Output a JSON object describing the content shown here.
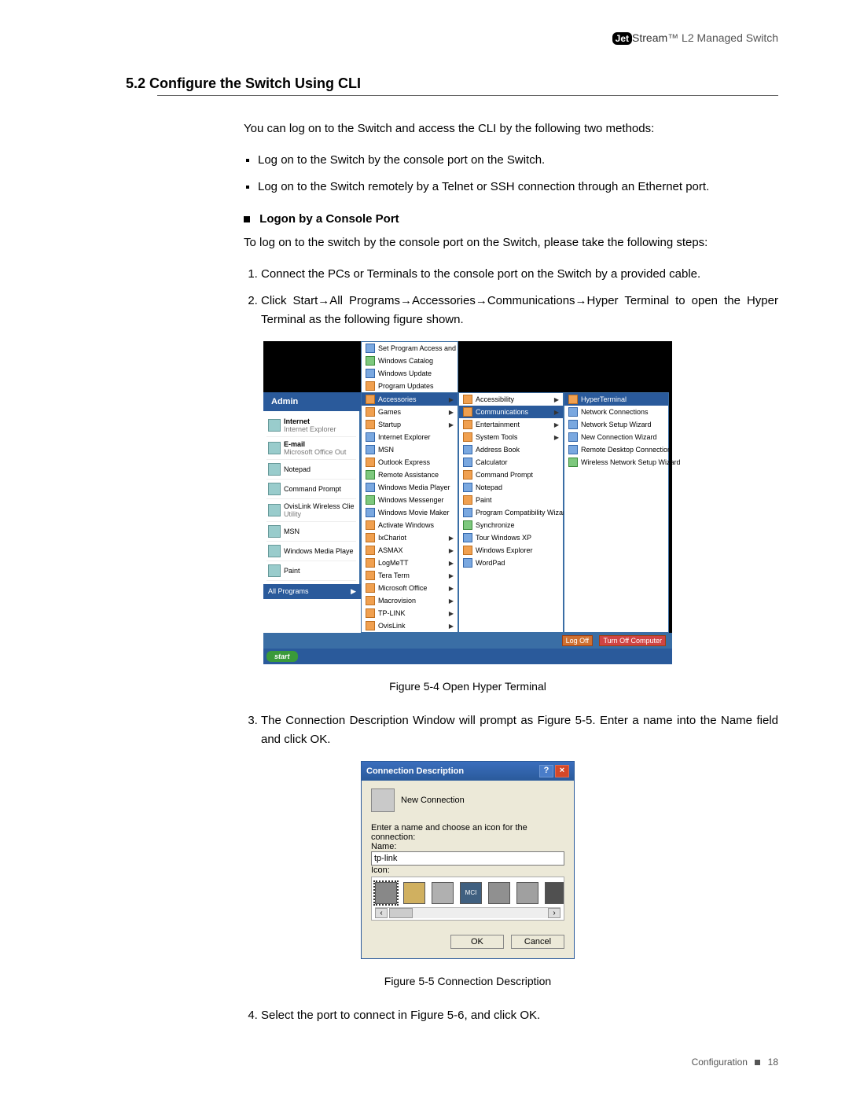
{
  "header": {
    "brand_jet": "Jet",
    "brand_stream": "Stream",
    "brand_tm": "™",
    "product": "L2 Managed Switch"
  },
  "section": {
    "number_title": "5.2 Configure the Switch Using CLI"
  },
  "intro": "You can log on to the Switch and access the CLI by the following two methods:",
  "bullets": [
    "Log on to the Switch by the console port on the Switch.",
    "Log on to the Switch remotely by a Telnet or SSH connection through an Ethernet port."
  ],
  "sub_heading": "Logon by a Console Port",
  "sub_text": "To log on to the switch by the console port on the Switch, please take the following steps:",
  "steps_first": [
    "Connect the PCs or Terminals to the console port on the Switch by a provided cable.",
    "Click Start→All Programs→Accessories→Communications→Hyper Terminal to open the Hyper Terminal as the following figure shown."
  ],
  "figure1_caption": "Figure 5-4  Open Hyper Terminal",
  "step3": "The Connection Description Window will prompt as Figure 5-5. Enter a name into the Name field and click OK.",
  "figure2_caption": "Figure 5-5  Connection Description",
  "step4": "Select the port to connect in Figure 5-6, and click OK.",
  "footer": {
    "section": "Configuration",
    "page": "18"
  },
  "startmenu": {
    "top_items": [
      "Set Program Access and Defaults",
      "Windows Catalog",
      "Windows Update",
      "Program Updates"
    ],
    "admin": "Admin",
    "pinned": [
      {
        "title": "Internet",
        "sub": "Internet Explorer"
      },
      {
        "title": "E-mail",
        "sub": "Microsoft Office Out"
      },
      {
        "title": "Notepad",
        "sub": ""
      },
      {
        "title": "Command Prompt",
        "sub": ""
      },
      {
        "title": "OvisLink Wireless Clie",
        "sub": "Utility"
      },
      {
        "title": "MSN",
        "sub": ""
      },
      {
        "title": "Windows Media Playe",
        "sub": ""
      },
      {
        "title": "Paint",
        "sub": ""
      }
    ],
    "all_programs": "All Programs",
    "col1_hl": "Accessories",
    "col1": [
      "Games",
      "Startup",
      "Internet Explorer",
      "MSN",
      "Outlook Express",
      "Remote Assistance",
      "Windows Media Player",
      "Windows Messenger",
      "Windows Movie Maker",
      "Activate Windows",
      "IxChariot",
      "ASMAX",
      "LogMeTT",
      "Tera Term",
      "Microsoft Office",
      "Macrovision",
      "TP-LINK",
      "OvisLink"
    ],
    "col2_top": "Accessibility",
    "col2_hl": "Communications",
    "col2": [
      "Entertainment",
      "System Tools",
      "Address Book",
      "Calculator",
      "Command Prompt",
      "Notepad",
      "Paint",
      "Program Compatibility Wizard",
      "Synchronize",
      "Tour Windows XP",
      "Windows Explorer",
      "WordPad"
    ],
    "col3_hl": "HyperTerminal",
    "col3": [
      "Network Connections",
      "Network Setup Wizard",
      "New Connection Wizard",
      "Remote Desktop Connection",
      "Wireless Network Setup Wizard"
    ],
    "logoff": "Log Off",
    "turnoff": "Turn Off Computer",
    "start": "start"
  },
  "dialog": {
    "title": "Connection Description",
    "new_conn": "New Connection",
    "prompt": "Enter a name and choose an icon for the connection:",
    "name_label": "Name:",
    "name_value": "tp-link",
    "icon_label": "Icon:",
    "ok": "OK",
    "cancel": "Cancel"
  }
}
